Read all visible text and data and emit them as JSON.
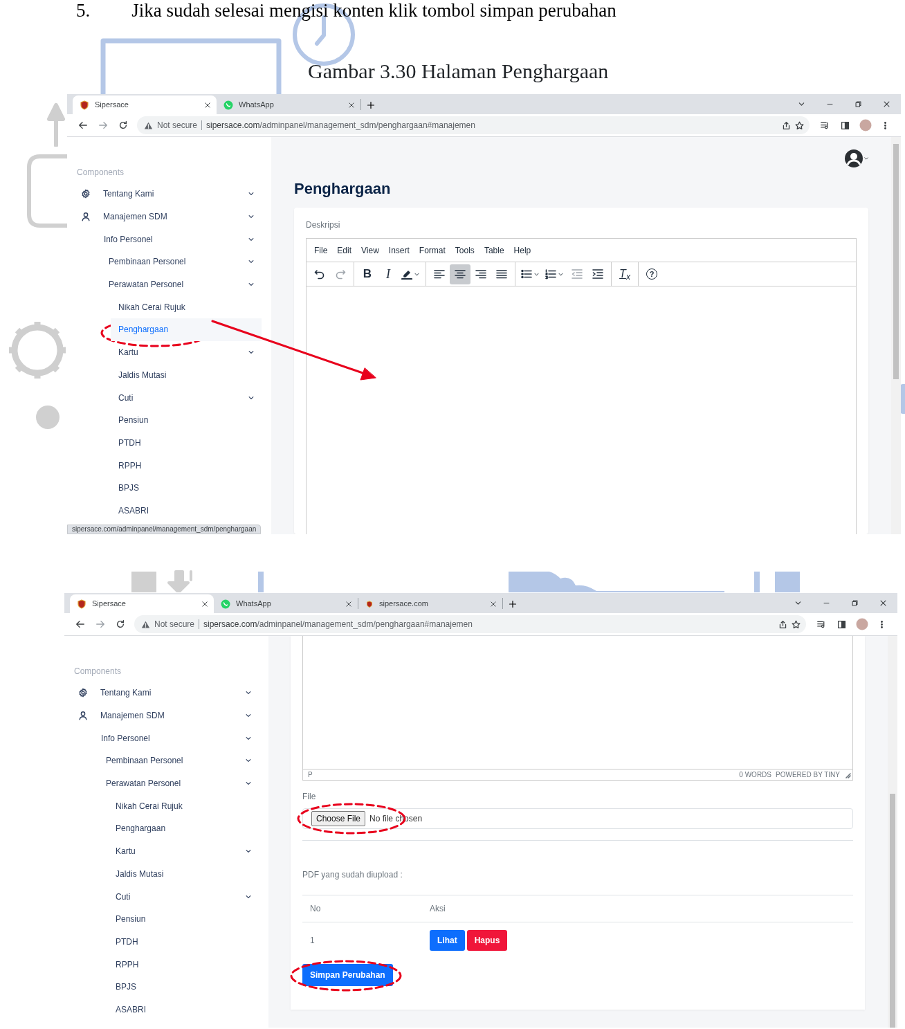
{
  "document": {
    "step_number": "5.",
    "step_text": "Jika sudah selesai mengisi konten klik tombol simpan perubahan",
    "caption": "Gambar 3.30 Halaman Penghargaan"
  },
  "screenshots": [
    {
      "tabs": [
        {
          "title": "Sipersace",
          "kind": "shield",
          "selected": true
        },
        {
          "title": "WhatsApp",
          "kind": "whatsapp",
          "selected": false
        }
      ],
      "address": {
        "security": "Not secure",
        "host": "sipersace.com",
        "path": "/adminpanel/management_sdm/penghargaan#manajemen"
      },
      "annotation_arrow": true,
      "link_preview": "sipersace.com/adminpanel/management_sdm/penghargaan",
      "sidebar": {
        "heading": "Components",
        "items": [
          {
            "label": "Tentang Kami",
            "expandable": true,
            "selected": false,
            "circled": false
          },
          {
            "label": "Manajemen SDM",
            "expandable": true,
            "selected": false,
            "circled": false,
            "children": [
              {
                "label": "Info Personel",
                "expandable": true,
                "selected": false,
                "circled": false,
                "children": [
                  {
                    "label": "Pembinaan Personel",
                    "expandable": true,
                    "selected": false,
                    "circled": false
                  },
                  {
                    "label": "Perawatan Personel",
                    "expandable": true,
                    "selected": false,
                    "circled": false,
                    "children": [
                      {
                        "label": "Nikah Cerai Rujuk",
                        "expandable": false,
                        "selected": false,
                        "circled": false
                      },
                      {
                        "label": "Penghargaan",
                        "expandable": false,
                        "selected": true,
                        "circled": true
                      },
                      {
                        "label": "Kartu",
                        "expandable": true,
                        "selected": false,
                        "circled": false
                      },
                      {
                        "label": "Jaldis Mutasi",
                        "expandable": false,
                        "selected": false,
                        "circled": false
                      },
                      {
                        "label": "Cuti",
                        "expandable": true,
                        "selected": false,
                        "circled": false
                      },
                      {
                        "label": "Pensiun",
                        "expandable": false,
                        "selected": false,
                        "circled": false
                      },
                      {
                        "label": "PTDH",
                        "expandable": false,
                        "selected": false,
                        "circled": false
                      },
                      {
                        "label": "RPPH",
                        "expandable": false,
                        "selected": false,
                        "circled": false
                      },
                      {
                        "label": "BPJS",
                        "expandable": false,
                        "selected": false,
                        "circled": false
                      },
                      {
                        "label": "ASABRI",
                        "expandable": false,
                        "selected": false,
                        "circled": false
                      }
                    ]
                  }
                ]
              }
            ]
          }
        ]
      },
      "content": {
        "heading": "Penghargaan",
        "label": "Deskripsi",
        "menubar": [
          "File",
          "Edit",
          "View",
          "Insert",
          "Format",
          "Tools",
          "Table",
          "Help"
        ],
        "toolbar": [
          [
            {
              "kind": "undo",
              "disabled": false,
              "active": false,
              "has_menu": false
            },
            {
              "kind": "redo",
              "disabled": true,
              "active": false,
              "has_menu": false
            }
          ],
          [
            {
              "kind": "bold",
              "label": "B",
              "disabled": false,
              "active": false,
              "has_menu": false
            },
            {
              "kind": "italic",
              "label": "I",
              "disabled": false,
              "active": false,
              "has_menu": false
            },
            {
              "kind": "highlight",
              "disabled": false,
              "active": false,
              "has_menu": true
            }
          ],
          [
            {
              "kind": "align_left",
              "disabled": false,
              "active": false,
              "has_menu": false
            },
            {
              "kind": "align_center",
              "disabled": false,
              "active": true,
              "has_menu": false
            },
            {
              "kind": "align_right",
              "disabled": false,
              "active": false,
              "has_menu": false
            },
            {
              "kind": "justify",
              "disabled": false,
              "active": false,
              "has_menu": false
            }
          ],
          [
            {
              "kind": "bullets",
              "disabled": false,
              "active": false,
              "has_menu": true
            },
            {
              "kind": "numbers",
              "disabled": false,
              "active": false,
              "has_menu": true
            },
            {
              "kind": "outdent",
              "disabled": true,
              "active": false,
              "has_menu": false
            },
            {
              "kind": "indent",
              "disabled": false,
              "active": false,
              "has_menu": false
            }
          ],
          [
            {
              "kind": "clear_format",
              "label": "T$_{x}$",
              "disabled": false,
              "active": false,
              "has_menu": false
            }
          ],
          [
            {
              "kind": "help",
              "label": "?",
              "disabled": false,
              "active": false,
              "has_menu": false
            }
          ]
        ]
      }
    },
    {
      "tabs": [
        {
          "title": "Sipersace",
          "kind": "shield",
          "selected": true
        },
        {
          "title": "WhatsApp",
          "kind": "whatsapp",
          "selected": false
        },
        {
          "title": "sipersace.com",
          "kind": "shield_small",
          "selected": false
        }
      ],
      "address": {
        "security": "Not secure",
        "host": "sipersace.com",
        "path": "/adminpanel/management_sdm/penghargaan#manajemen"
      },
      "annotation_arrow": false,
      "sidebar": {
        "heading": "Components",
        "items": [
          {
            "label": "Tentang Kami",
            "expandable": true,
            "selected": false,
            "circled": false
          },
          {
            "label": "Manajemen SDM",
            "expandable": true,
            "selected": false,
            "circled": false,
            "children": [
              {
                "label": "Info Personel",
                "expandable": true,
                "selected": false,
                "circled": false,
                "children": [
                  {
                    "label": "Pembinaan Personel",
                    "expandable": true,
                    "selected": false,
                    "circled": false
                  },
                  {
                    "label": "Perawatan Personel",
                    "expandable": true,
                    "selected": false,
                    "circled": false,
                    "children": [
                      {
                        "label": "Nikah Cerai Rujuk",
                        "expandable": false,
                        "selected": false,
                        "circled": false
                      },
                      {
                        "label": "Penghargaan",
                        "expandable": false,
                        "selected": false,
                        "circled": false
                      },
                      {
                        "label": "Kartu",
                        "expandable": true,
                        "selected": false,
                        "circled": false
                      },
                      {
                        "label": "Jaldis Mutasi",
                        "expandable": false,
                        "selected": false,
                        "circled": false
                      },
                      {
                        "label": "Cuti",
                        "expandable": true,
                        "selected": false,
                        "circled": false
                      },
                      {
                        "label": "Pensiun",
                        "expandable": false,
                        "selected": false,
                        "circled": false
                      },
                      {
                        "label": "PTDH",
                        "expandable": false,
                        "selected": false,
                        "circled": false
                      },
                      {
                        "label": "RPPH",
                        "expandable": false,
                        "selected": false,
                        "circled": false
                      },
                      {
                        "label": "BPJS",
                        "expandable": false,
                        "selected": false,
                        "circled": false
                      },
                      {
                        "label": "ASABRI",
                        "expandable": false,
                        "selected": false,
                        "circled": false
                      }
                    ]
                  }
                ]
              }
            ]
          }
        ]
      },
      "content": {
        "editor_status": {
          "path": "P",
          "words": "0 WORDS",
          "branding": "POWERED BY TINY"
        },
        "file": {
          "label": "File",
          "button": "Choose File",
          "status": "No file chosen",
          "circled": true
        },
        "uploads_label": "PDF yang sudah diupload :",
        "table": {
          "columns": [
            "No",
            "Aksi"
          ],
          "rows": [
            {
              "no": "1",
              "actions": [
                {
                  "label": "Lihat"
                },
                {
                  "label": "Hapus"
                }
              ]
            }
          ]
        },
        "save": {
          "label": "Simpan Perubahan",
          "circled": true
        }
      }
    }
  ]
}
